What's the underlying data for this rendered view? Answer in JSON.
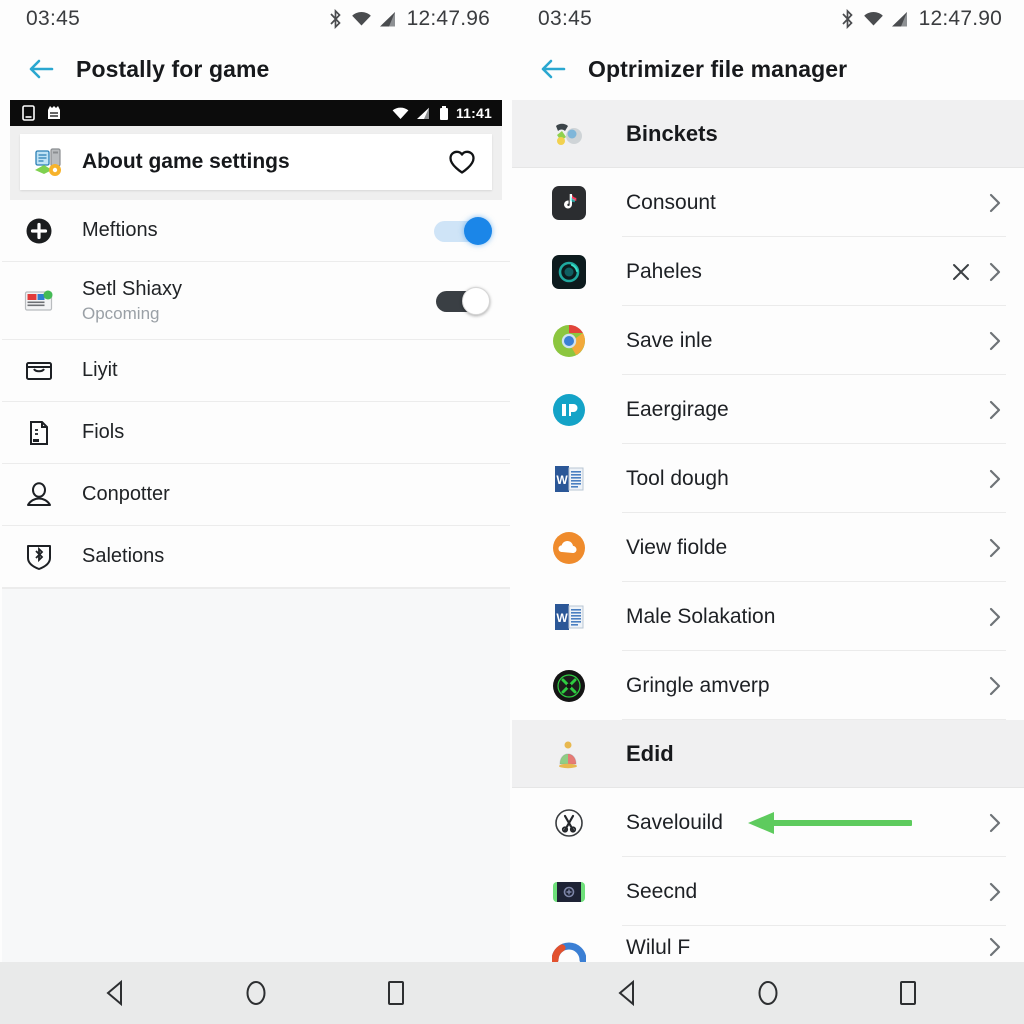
{
  "left": {
    "status_bar": {
      "time": "03:45",
      "clock_right": "12:47.96",
      "bluetooth_icon": "bluetooth-icon",
      "wifi_icon": "wifi-icon",
      "signal_icon": "signal-icon"
    },
    "app_bar": {
      "back_icon": "back-arrow-icon",
      "title": "Postally for game"
    },
    "inner_status_bar": {
      "clock": "11:41",
      "sim_icon": "sim-card-icon",
      "app_icon": "app-notification-icon",
      "wifi_icon": "wifi-icon",
      "signal_icon": "signal-icon",
      "battery_icon": "battery-icon"
    },
    "hero_card": {
      "icon": "game-settings-icon",
      "title": "About game settings",
      "favorite_icon": "heart-outline-icon"
    },
    "items": [
      {
        "icon": "plus-circle-icon",
        "label": "Meftions",
        "sub": "",
        "control": "toggle",
        "toggle_state": "on"
      },
      {
        "icon": "news-app-icon",
        "label": "Setl Shiaxy",
        "sub": "Opcoming",
        "control": "toggle",
        "toggle_state": "off"
      },
      {
        "icon": "inbox-icon",
        "label": "Liyit",
        "sub": "",
        "control": "none",
        "toggle_state": ""
      },
      {
        "icon": "document-icon",
        "label": "Fiols",
        "sub": "",
        "control": "none",
        "toggle_state": ""
      },
      {
        "icon": "person-icon",
        "label": "Conpotter",
        "sub": "",
        "control": "none",
        "toggle_state": ""
      },
      {
        "icon": "shield-bluetooth-icon",
        "label": "Saletions",
        "sub": "",
        "control": "none",
        "toggle_state": ""
      }
    ]
  },
  "right": {
    "status_bar": {
      "time": "03:45",
      "clock_right": "12:47.90",
      "bluetooth_icon": "bluetooth-icon",
      "wifi_icon": "wifi-icon",
      "signal_icon": "signal-icon"
    },
    "app_bar": {
      "back_icon": "back-arrow-icon",
      "title": "Optrimizer file manager"
    },
    "sections": [
      {
        "header": {
          "icon": "buckets-folder-icon",
          "label": "Binckets"
        },
        "items": [
          {
            "icon": "tiktok-icon",
            "label": "Consount",
            "has_x": false,
            "annotated": false
          },
          {
            "icon": "teal-circle-icon",
            "label": "Paheles",
            "has_x": true,
            "annotated": false
          },
          {
            "icon": "chrome-icon",
            "label": "Save inle",
            "has_x": false,
            "annotated": false
          },
          {
            "icon": "help-badge-icon",
            "label": "Eaergirage",
            "has_x": false,
            "annotated": false
          },
          {
            "icon": "word-doc-icon",
            "label": "Tool dough",
            "has_x": false,
            "annotated": false
          },
          {
            "icon": "orange-cloud-icon",
            "label": "View fiolde",
            "has_x": false,
            "annotated": false
          },
          {
            "icon": "word-doc-icon",
            "label": "Male Solakation",
            "has_x": false,
            "annotated": false
          },
          {
            "icon": "green-x-badge-icon",
            "label": "Gringle amverp",
            "has_x": false,
            "annotated": false
          }
        ]
      },
      {
        "header": {
          "icon": "edid-avatar-icon",
          "label": "Edid"
        },
        "items": [
          {
            "icon": "scissors-circle-icon",
            "label": "Savelouild",
            "has_x": false,
            "annotated": true
          },
          {
            "icon": "dark-badge-icon",
            "label": "Seecnd",
            "has_x": false,
            "annotated": false
          },
          {
            "icon": "arc-gauge-icon",
            "label": "Wilul F",
            "has_x": false,
            "annotated": false
          }
        ]
      }
    ],
    "annotation": {
      "type": "arrow-left",
      "color": "#5ecb5e",
      "points_to": "Savelouild"
    }
  },
  "nav_bar": {
    "back": "nav-back-triangle-icon",
    "home": "nav-home-circle-icon",
    "recents": "nav-recents-square-icon"
  },
  "colors": {
    "accent_blue": "#1b86e8",
    "back_arrow": "#2aa7d0",
    "annotation_green": "#5ecb5e",
    "panel_bg": "#fbfbfb",
    "nav_bg": "#e9eaea"
  }
}
